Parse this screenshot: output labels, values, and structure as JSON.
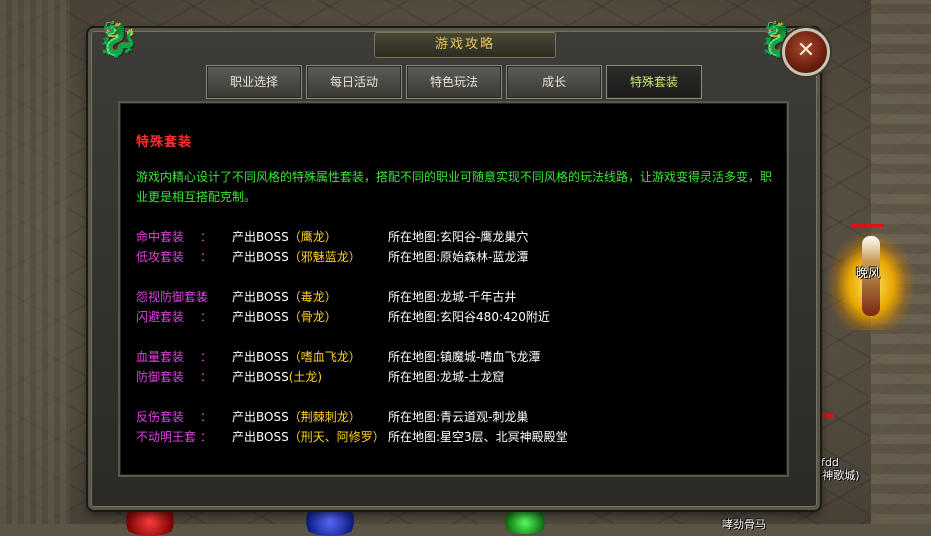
{
  "window": {
    "title": "游戏攻略",
    "close_icon": "close-x-icon"
  },
  "tabs": [
    {
      "label": "职业选择",
      "active": false
    },
    {
      "label": "每日活动",
      "active": false
    },
    {
      "label": "特色玩法",
      "active": false
    },
    {
      "label": "成长",
      "active": false
    },
    {
      "label": "特殊套装",
      "active": true
    }
  ],
  "section": {
    "title": "特殊套装",
    "intro": "游戏内精心设计了不同风格的特殊属性套装，搭配不同的职业可随意实现不同风格的玩法线路，让游戏变得灵活多变，职业更是相互搭配克制。"
  },
  "sets": [
    {
      "name": "命中套装",
      "colon": "：",
      "boss_prefix": "产出BOSS",
      "boss": "（鹰龙）",
      "map": "所在地图:玄阳谷-鹰龙巢穴"
    },
    {
      "name": "低攻套装",
      "colon": "：",
      "boss_prefix": "产出BOSS",
      "boss": "（邪魅蓝龙）",
      "map": "所在地图:原始森林-蓝龙潭"
    },
    {
      "name": "怨视防御套装",
      "colon": "：",
      "boss_prefix": "产出BOSS",
      "boss": "（毒龙）",
      "map": "所在地图:龙城-千年古井"
    },
    {
      "name": "闪避套装",
      "colon": "：",
      "boss_prefix": "产出BOSS",
      "boss": "（骨龙）",
      "map": "所在地图:玄阳谷480:420附近"
    },
    {
      "name": "血量套装",
      "colon": "：",
      "boss_prefix": "产出BOSS",
      "boss": "（嗜血飞龙）",
      "map": "所在地图:镇魔城-嗜血飞龙潭"
    },
    {
      "name": "防御套装",
      "colon": "：",
      "boss_prefix": "产出BOSS",
      "boss": "(土龙)",
      "map": "所在地图:龙城-土龙窟"
    },
    {
      "name": "反伤套装",
      "colon": "：",
      "boss_prefix": "产出BOSS",
      "boss": "（荆棘刺龙）",
      "map": "所在地图:青云道观-刺龙巢"
    },
    {
      "name": "不动明王套",
      "colon": "：",
      "boss_prefix": "产出BOSS",
      "boss": "（刑天、阿修罗）",
      "map": "所在地图:星空3层、北冥神殿殿堂"
    }
  ],
  "world": {
    "npc_name": "晚风",
    "player_name": "ifdd",
    "player_guild": "(神歌城)",
    "player3_name": "哮劲骨马"
  },
  "colors": {
    "section_title": "#ff2d2d",
    "intro_text": "#39e639",
    "set_name": "#e040e0",
    "boss_name": "#ffd21f",
    "active_tab_text": "#c8e878",
    "window_title": "#e8c55a"
  }
}
